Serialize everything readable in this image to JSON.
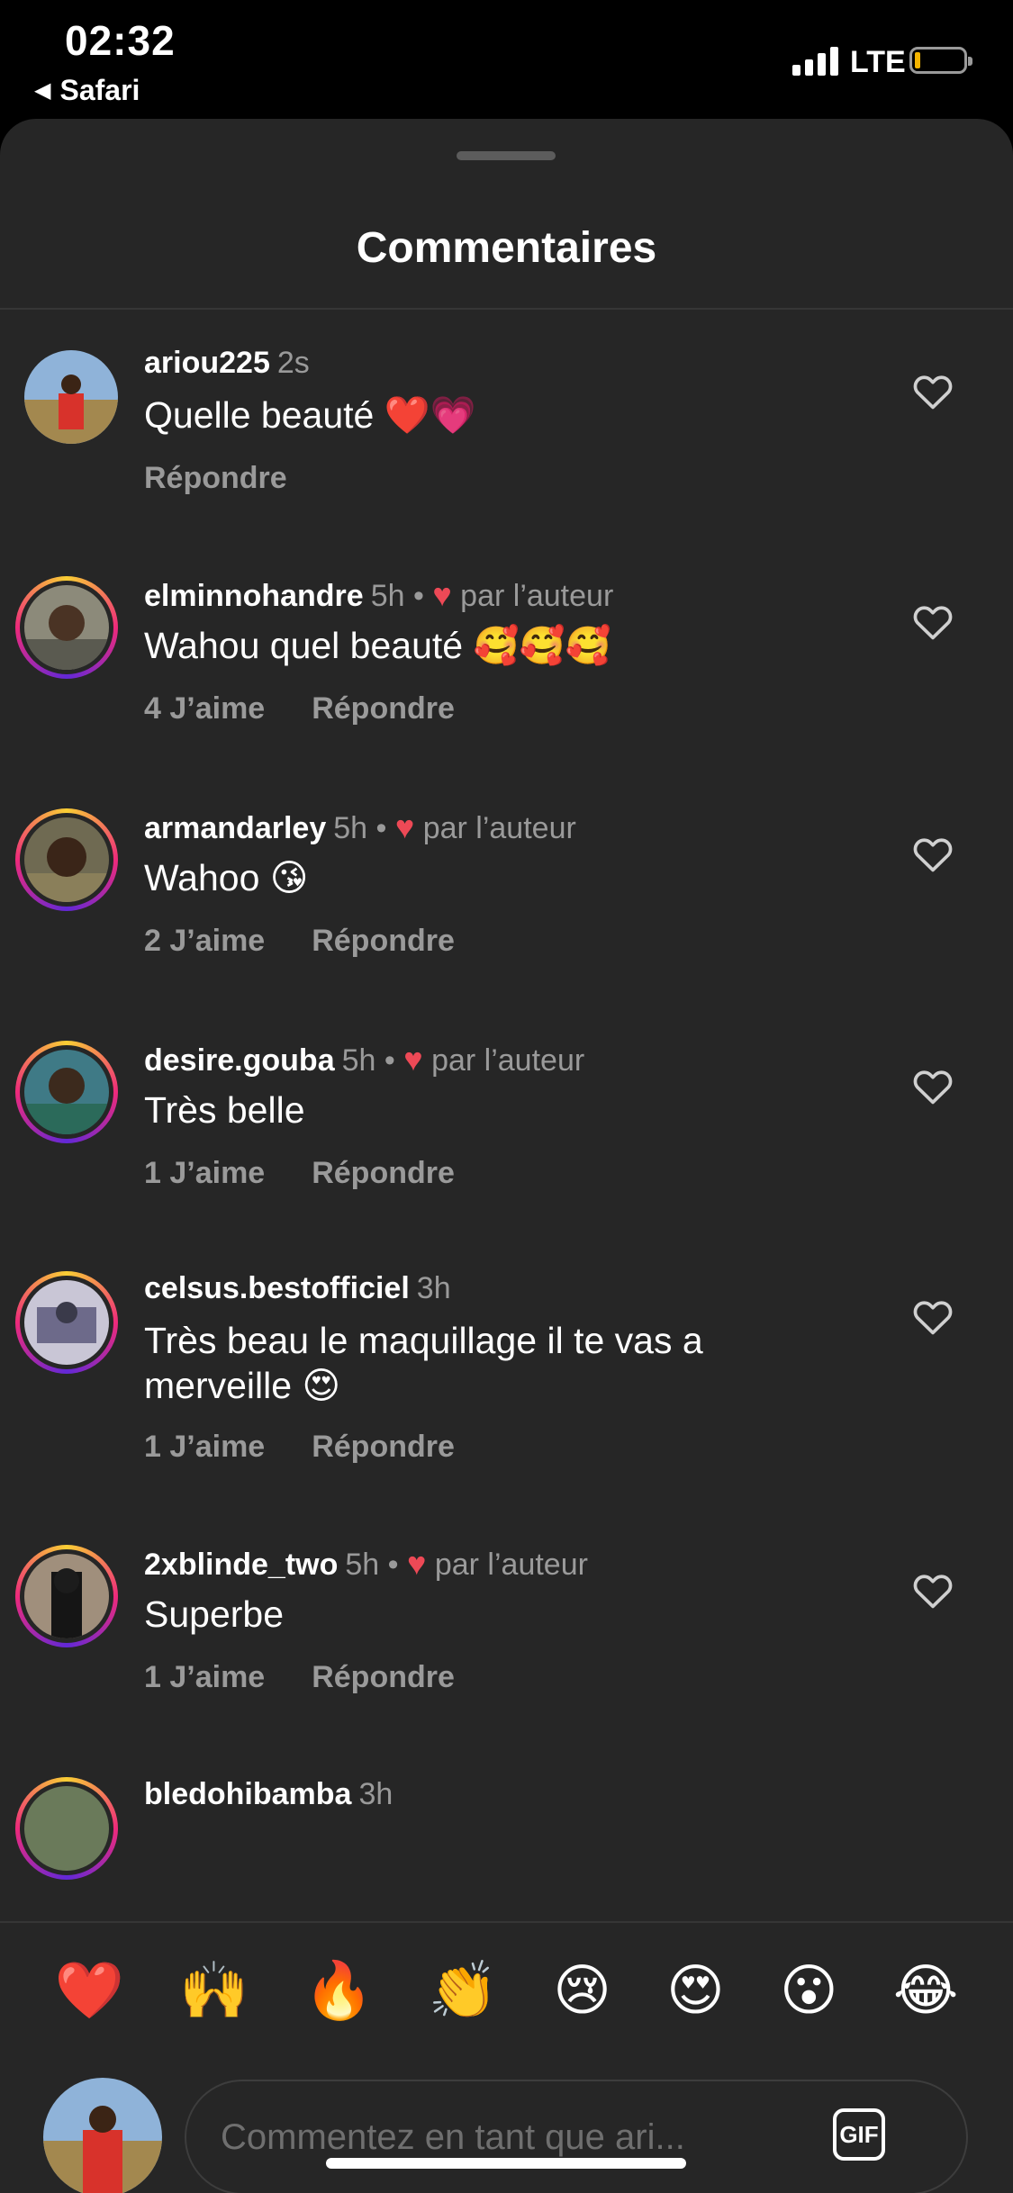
{
  "status_bar": {
    "time": "02:32",
    "back_app": "Safari",
    "network": "LTE"
  },
  "sheet": {
    "title": "Commentaires"
  },
  "comments": [
    {
      "username": "ariou225",
      "time": "2s",
      "liked_by_author": false,
      "author_label": "",
      "text": "Quelle beauté ❤️💗",
      "likes_label": "",
      "reply_label": "Répondre"
    },
    {
      "username": "elminnohandre",
      "time": "5h",
      "liked_by_author": true,
      "author_label": "par l’auteur",
      "text": "Wahou quel beauté 🥰🥰🥰",
      "likes_label": "4 J’aime",
      "reply_label": "Répondre"
    },
    {
      "username": "armandarley",
      "time": "5h",
      "liked_by_author": true,
      "author_label": "par l’auteur",
      "text": "Wahoo 😘",
      "likes_label": "2 J’aime",
      "reply_label": "Répondre"
    },
    {
      "username": "desire.gouba",
      "time": "5h",
      "liked_by_author": true,
      "author_label": "par l’auteur",
      "text": "Très belle",
      "likes_label": "1 J’aime",
      "reply_label": "Répondre"
    },
    {
      "username": "celsus.bestofficiel",
      "time": "3h",
      "liked_by_author": false,
      "author_label": "",
      "text": "Très beau le maquillage il te vas a merveille 😍",
      "likes_label": "1 J’aime",
      "reply_label": "Répondre"
    },
    {
      "username": "2xblinde_two",
      "time": "5h",
      "liked_by_author": true,
      "author_label": "par l’auteur",
      "text": "Superbe",
      "likes_label": "1 J’aime",
      "reply_label": "Répondre"
    },
    {
      "username": "bledohibamba",
      "time": "3h",
      "liked_by_author": false,
      "author_label": "",
      "text": "",
      "likes_label": "",
      "reply_label": ""
    }
  ],
  "quick_reactions": [
    "❤️",
    "🙌",
    "🔥",
    "👏",
    "😢",
    "😍",
    "😮",
    "😂"
  ],
  "composer": {
    "placeholder": "Commentez en tant que ari...",
    "gif_label": "GIF"
  },
  "colors": {
    "background": "#262626",
    "muted_text": "#9a9a9a",
    "heart_red": "#ed4956"
  }
}
